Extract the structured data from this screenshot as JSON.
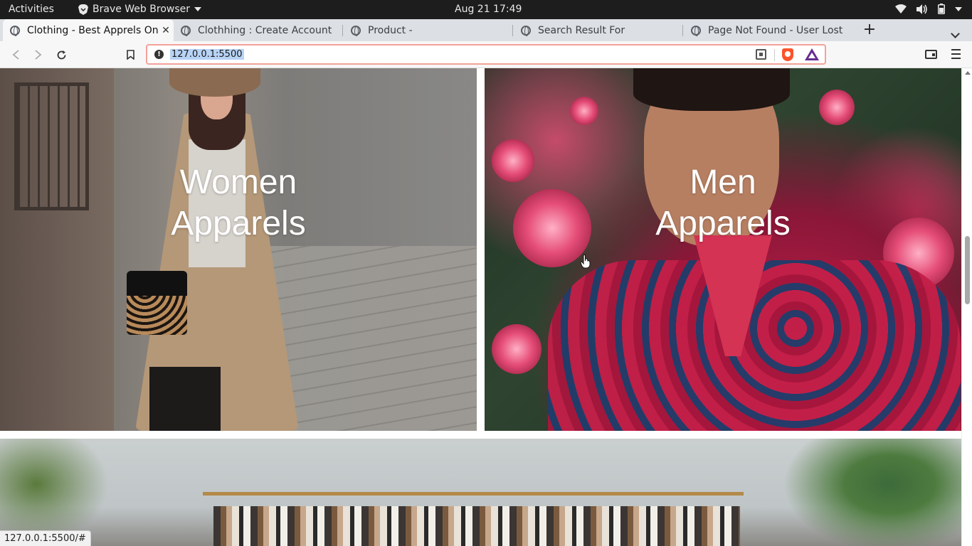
{
  "system_bar": {
    "activities": "Activities",
    "app_name": "Brave Web Browser",
    "datetime": "Aug 21  17:49"
  },
  "tabs": [
    {
      "title": "Clothing - Best Apprels On",
      "active": true
    },
    {
      "title": "Clothhing : Create Account",
      "active": false
    },
    {
      "title": "Product -",
      "active": false
    },
    {
      "title": "Search Result For",
      "active": false
    },
    {
      "title": "Page Not Found - User Lost",
      "active": false
    }
  ],
  "toolbar": {
    "url": "127.0.0.1:5500"
  },
  "page": {
    "cards": [
      {
        "line1": "Women",
        "line2": "Apparels"
      },
      {
        "line1": "Men",
        "line2": "Apparels"
      }
    ]
  },
  "status_url": "127.0.0.1:5500/#",
  "colors": {
    "url_focus_border": "#f4a29a",
    "brave_orange": "#fb542b",
    "bat_purple": "#662d91",
    "selection": "#b7d3f5"
  }
}
